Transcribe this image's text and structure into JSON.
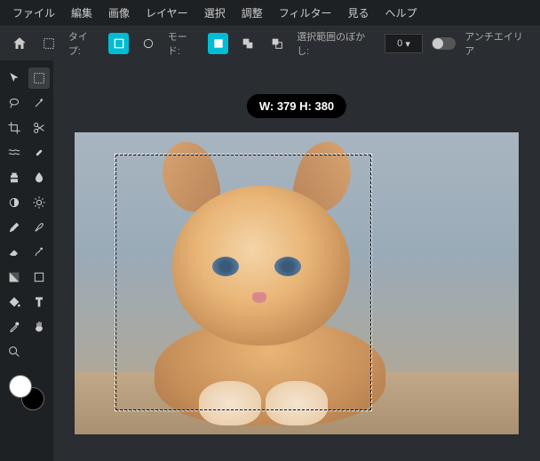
{
  "menu": {
    "file": "ファイル",
    "edit": "編集",
    "image": "画像",
    "layer": "レイヤー",
    "select": "選択",
    "adjust": "調整",
    "filter": "フィルター",
    "view": "見る",
    "help": "ヘルプ"
  },
  "toolbar": {
    "type_label": "タイプ:",
    "mode_label": "モード:",
    "feather_label": "選択範囲のぼかし:",
    "feather_value": "0",
    "antialias_label": "アンチエイリア"
  },
  "selection": {
    "badge_text": "W: 379 H: 380"
  },
  "colors": {
    "foreground": "#ffffff",
    "background": "#000000"
  }
}
